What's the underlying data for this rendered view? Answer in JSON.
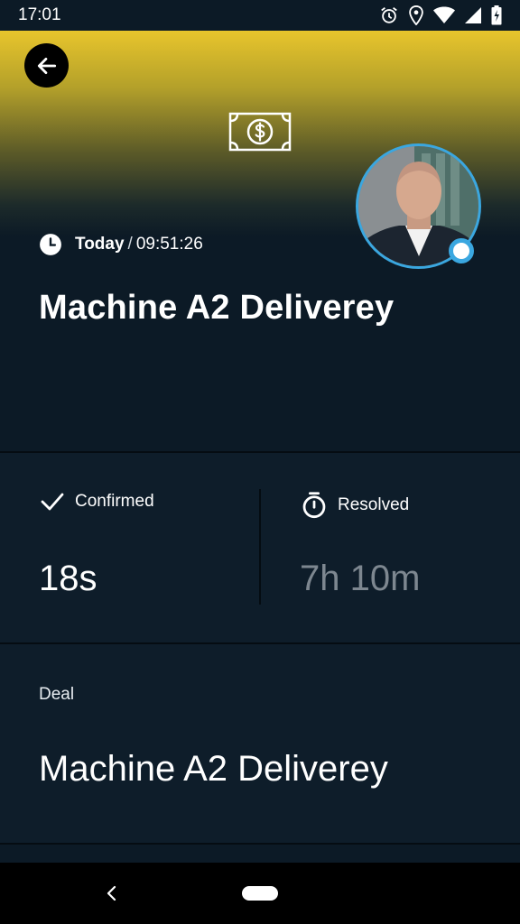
{
  "status_bar": {
    "time": "17:01"
  },
  "header": {
    "icon": "money-bill-icon"
  },
  "event": {
    "day": "Today",
    "separator": "/",
    "time": "09:51:26",
    "title": "Machine A2 Deliverey"
  },
  "stats": {
    "confirmed": {
      "label": "Confirmed",
      "value": "18s"
    },
    "resolved": {
      "label": "Resolved",
      "value": "7h 10m"
    }
  },
  "deal": {
    "label": "Deal",
    "value": "Machine A2 Deliverey"
  },
  "colors": {
    "background": "#0c1a26",
    "card": "#0e1d2a",
    "accent_yellow": "#e8c52c",
    "avatar_ring": "#3aa7e0",
    "muted_text": "#7d8790"
  }
}
